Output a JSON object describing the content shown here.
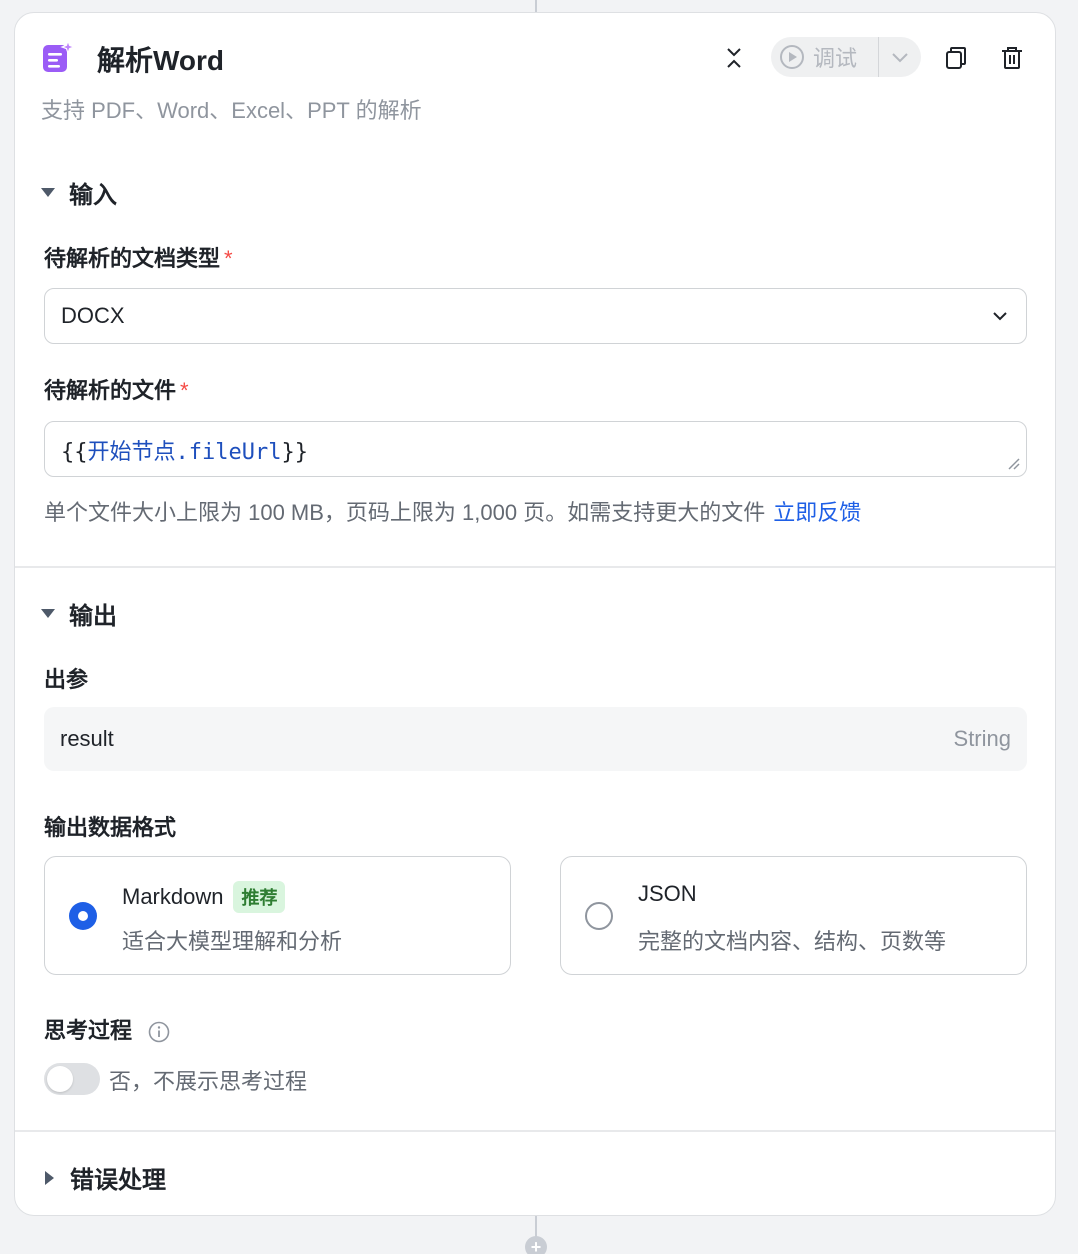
{
  "node": {
    "title": "解析Word",
    "description": "支持 PDF、Word、Excel、PPT 的解析",
    "debug_label": "调试"
  },
  "input": {
    "section_title": "输入",
    "doc_type_label": "待解析的文档类型",
    "doc_type_value": "DOCX",
    "file_label": "待解析的文件",
    "file_value_prefix": "{{",
    "file_value_ref": "开始节点.fileUrl",
    "file_value_suffix": "}}",
    "hint": "单个文件大小上限为 100 MB，页码上限为 1,000 页。如需支持更大的文件",
    "hint_link": "立即反馈",
    "required_mark": "*"
  },
  "output": {
    "section_title": "输出",
    "param_label": "出参",
    "param_name": "result",
    "param_type": "String",
    "format_label": "输出数据格式",
    "formats": [
      {
        "title": "Markdown",
        "badge": "推荐",
        "desc": "适合大模型理解和分析",
        "selected": true
      },
      {
        "title": "JSON",
        "badge": "",
        "desc": "完整的文档内容、结构、页数等",
        "selected": false
      }
    ],
    "thinking_label": "思考过程",
    "thinking_toggle_text": "否，不展示思考过程",
    "thinking_enabled": false
  },
  "error": {
    "section_title": "错误处理"
  },
  "colors": {
    "accent": "#1e5fe6",
    "icon_purple": "#9b5cf6",
    "required": "#f54a45",
    "badge_bg": "#d9f5de"
  },
  "connector_plus": "+"
}
